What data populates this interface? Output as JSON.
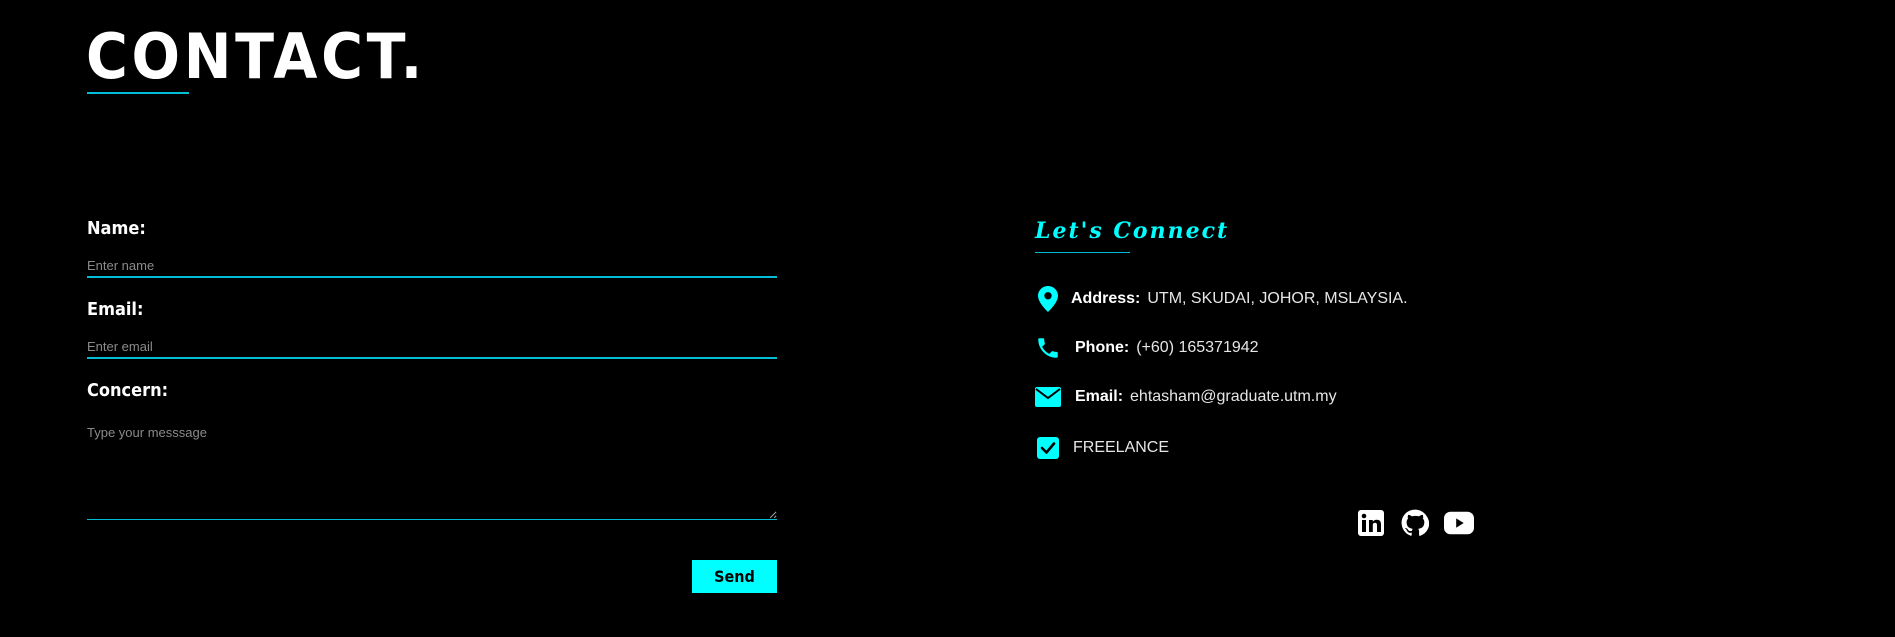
{
  "section": {
    "title": "CONTACT."
  },
  "form": {
    "name_label": "Name:",
    "name_placeholder": "Enter name",
    "email_label": "Email:",
    "email_placeholder": "Enter email",
    "concern_label": "Concern:",
    "concern_placeholder": "Type your messsage",
    "send_label": "Send"
  },
  "connect": {
    "title": "Let's  Connect",
    "address_key": "Address:",
    "address_value": "UTM, SKUDAI, JOHOR, MSLAYSIA.",
    "phone_key": "Phone:",
    "phone_value": "(+60) 165371942",
    "email_key": "Email:",
    "email_value": "ehtasham@graduate.utm.my",
    "freelance_value": "FREELANCE"
  },
  "socials": [
    "linkedin-icon",
    "github-icon",
    "youtube-icon"
  ],
  "colors": {
    "background": "#000000",
    "accent": "#00ffff",
    "underline": "#00bcd4",
    "text": "#ffffff"
  }
}
